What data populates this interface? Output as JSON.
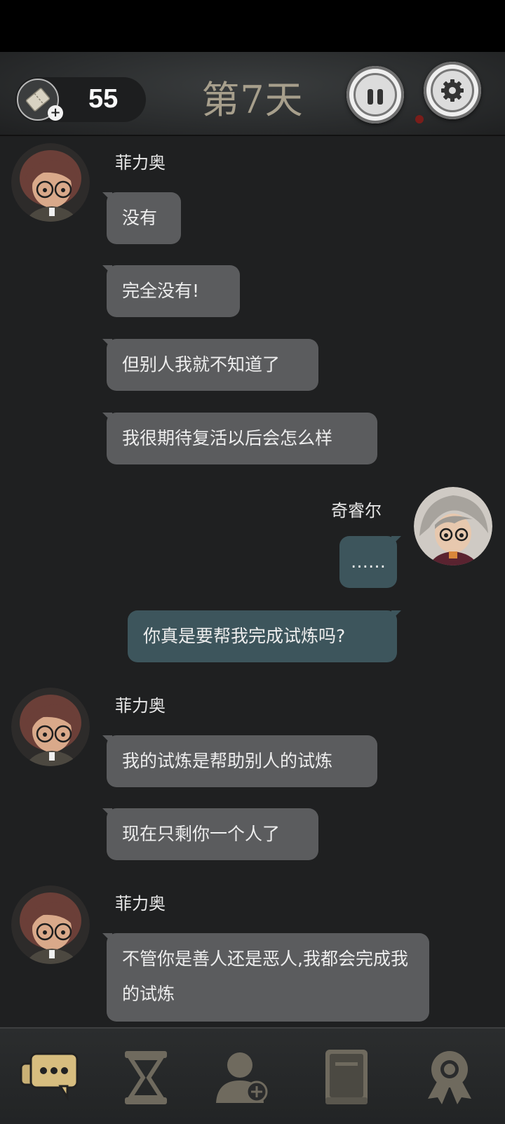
{
  "header": {
    "ticket_count": "55",
    "day_title": "第7天"
  },
  "messages": [
    {
      "sender": "菲力奥"
    },
    {
      "text": "没有"
    },
    {
      "text": "完全没有!"
    },
    {
      "text": "但别人我就不知道了"
    },
    {
      "text": "我很期待复活以后会怎么样"
    },
    {
      "sender": "奇睿尔"
    },
    {
      "text": "……"
    },
    {
      "text": "你真是要帮我完成试炼吗?"
    },
    {
      "sender": "菲力奥"
    },
    {
      "text": "我的试炼是帮助别人的试炼"
    },
    {
      "text": "现在只剩你一个人了"
    },
    {
      "sender": "菲力奥"
    },
    {
      "text": "不管你是善人还是恶人,我都会完成我的试炼"
    }
  ],
  "nav": [
    "chat-icon",
    "hourglass-icon",
    "add-friend-icon",
    "book-icon",
    "badge-icon"
  ],
  "colors": {
    "accent_gold": "#c9b075",
    "bubble_left": "#5b5c5e",
    "bubble_right": "#3d555c"
  }
}
